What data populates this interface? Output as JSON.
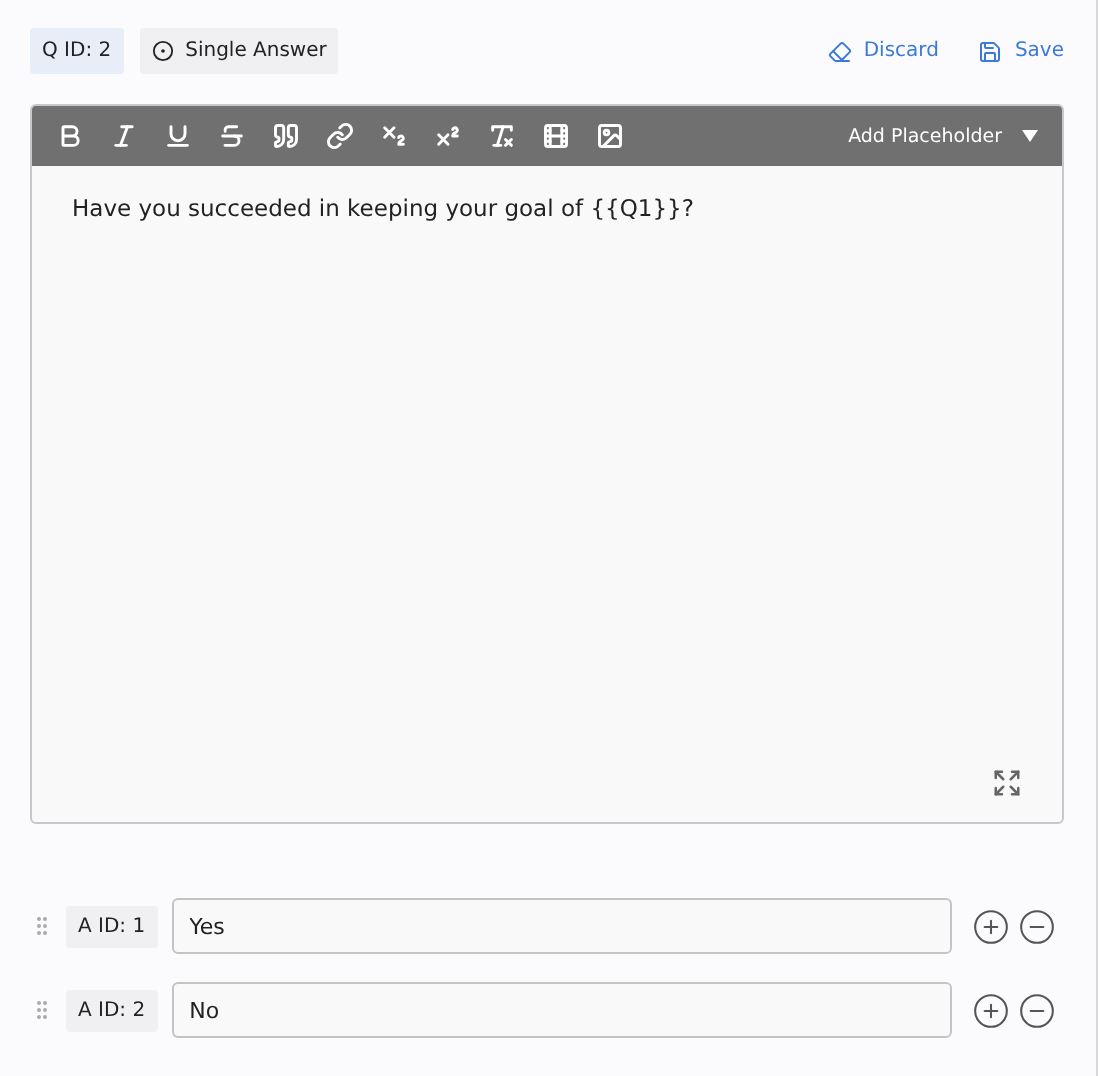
{
  "header": {
    "question_id": "Q ID: 2",
    "question_type": "Single Answer",
    "actions": [
      {
        "kind": "discard",
        "label": "Discard"
      },
      {
        "kind": "save",
        "label": "Save"
      }
    ]
  },
  "editor": {
    "toolbar": {
      "tools": [
        {
          "kind": "bold"
        },
        {
          "kind": "italic"
        },
        {
          "kind": "underline"
        },
        {
          "kind": "strike"
        },
        {
          "kind": "quote"
        },
        {
          "kind": "link"
        },
        {
          "kind": "subscript"
        },
        {
          "kind": "superscript"
        },
        {
          "kind": "clear"
        },
        {
          "kind": "video"
        },
        {
          "kind": "image"
        }
      ],
      "placeholder_menu": "Add Placeholder"
    },
    "text": "Have you succeeded in keeping your goal of {{Q1}}?"
  },
  "answers": [
    {
      "id_label": "A ID: 1",
      "value": "Yes"
    },
    {
      "id_label": "A ID: 2",
      "value": "No"
    }
  ]
}
